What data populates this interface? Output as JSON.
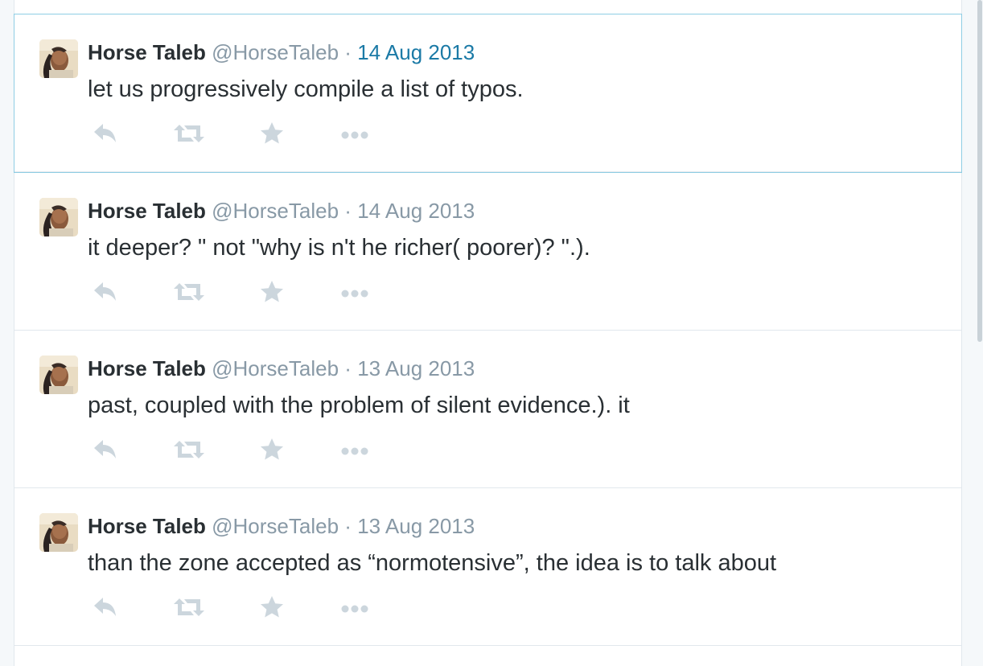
{
  "tweets": [
    {
      "fullname": "Horse Taleb",
      "username": "@HorseTaleb",
      "separator": "·",
      "date": "14 Aug 2013",
      "text": "let us progressively compile a list of typos.",
      "focused": true
    },
    {
      "fullname": "Horse Taleb",
      "username": "@HorseTaleb",
      "separator": "·",
      "date": "14 Aug 2013",
      "text": "it deeper? \" not \"why is n't he richer( poorer)? \".).",
      "focused": false
    },
    {
      "fullname": "Horse Taleb",
      "username": "@HorseTaleb",
      "separator": "·",
      "date": "13 Aug 2013",
      "text": "past, coupled with the problem of silent evidence.). it",
      "focused": false
    },
    {
      "fullname": "Horse Taleb",
      "username": "@HorseTaleb",
      "separator": "·",
      "date": "13 Aug 2013",
      "text": "than the zone accepted as “normotensive”, the idea is to talk about",
      "focused": false
    }
  ],
  "icons": {
    "reply": "reply-icon",
    "retweet": "retweet-icon",
    "favorite": "star-icon",
    "more": "more-icon"
  },
  "colors": {
    "name": "#292f33",
    "meta": "#8899a6",
    "active_link": "#1b7aa6",
    "action_icon": "#ccd6dd",
    "focus_border": "#8ecde4"
  }
}
